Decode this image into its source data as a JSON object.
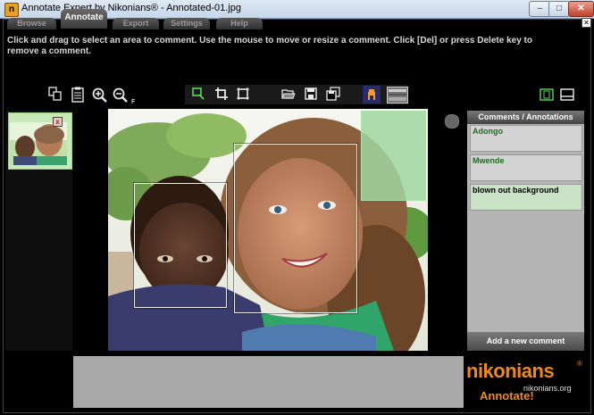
{
  "window": {
    "title": "Annotate Expert by Nikonians® - Annotated-01.jpg",
    "min": "–",
    "max": "□",
    "close": "✕"
  },
  "tabs": {
    "browse": "Browse",
    "annotate": "Annotate",
    "export": "Export",
    "settings": "Settings",
    "help": "Help",
    "active": "annotate"
  },
  "instructions": "Click and drag to select an area to comment. Use the mouse to move or resize a comment. Click [Del] or press Delete key to remove a comment.",
  "toolbar": {
    "zoom_hint": "F",
    "left_icons": [
      "copy-icon",
      "paste-icon",
      "zoom-in-icon",
      "zoom-out-icon"
    ],
    "center_icons": [
      "select-region-icon",
      "crop-icon",
      "crop-alt-icon",
      "open-folder-icon",
      "save-icon",
      "save-all-icon",
      "user-icon",
      "picture-icon"
    ],
    "right_icons": [
      "filmstrip-icon",
      "layout-icon"
    ]
  },
  "thumbnail": {
    "remove": "x"
  },
  "comments_panel": {
    "header": "Comments / Annotations",
    "items": [
      "Adongo",
      "Mwende",
      "blown out background"
    ],
    "selected_index": 2,
    "add_button": "Add a new comment"
  },
  "branding": {
    "logo": "nikonians",
    "registered": "®",
    "url": "nikonians.org",
    "tagline": "Annotate!",
    "accent": "#ee8a16"
  }
}
